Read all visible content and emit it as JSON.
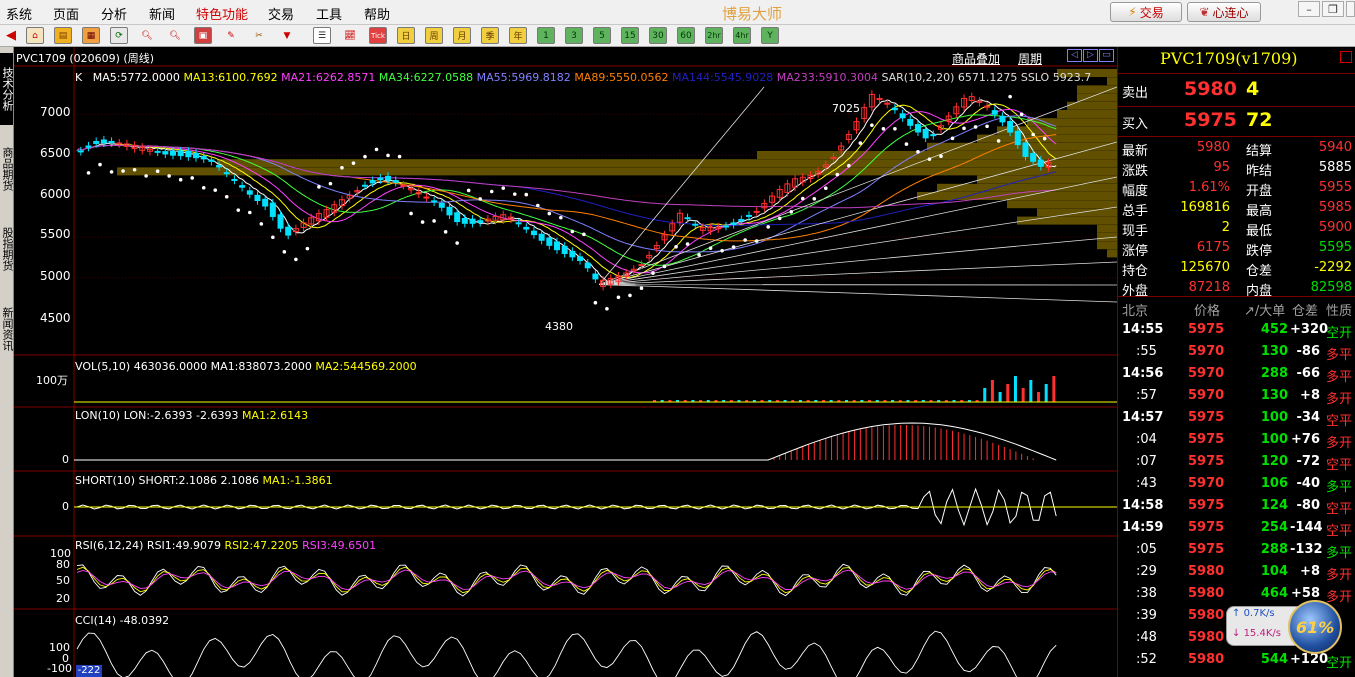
{
  "menubar": {
    "items": [
      "系统",
      "页面",
      "分析",
      "新闻",
      "特色功能",
      "交易",
      "工具",
      "帮助"
    ],
    "app_title": "博易大师",
    "trade_button": "交易",
    "xinlian_button": "心连心"
  },
  "toolbar": {
    "period_buttons": [
      "日",
      "周",
      "月",
      "季",
      "年"
    ],
    "minute_buttons": [
      "1",
      "3",
      "5",
      "15",
      "30",
      "60",
      "2hr",
      "4hr",
      "Y"
    ],
    "tick_label": "Tick"
  },
  "sidetabs": [
    "技术分析",
    "商品期货",
    "股指期货",
    "新闻资讯"
  ],
  "chart": {
    "header": "PVC1709 (020609) (周线)",
    "header_buttons": [
      "商品叠加",
      "周期"
    ],
    "ma_line": {
      "k": "K",
      "ma5": "MA5:5772.0000",
      "ma13": "MA13:6100.7692",
      "ma21": "MA21:6262.8571",
      "ma34": "MA34:6227.0588",
      "ma55": "MA55:5969.8182",
      "ma89": "MA89:5550.0562",
      "ma144": "MA144:5545.9028",
      "ma233": "MA233:5910.3004",
      "sar": "SAR(10,2,20) 6571.1275",
      "sslo": "SSLO 5923.7"
    },
    "price_axis": [
      "7000",
      "6500",
      "6000",
      "5500",
      "5000",
      "4500"
    ],
    "high_label": "7025",
    "low_label": "4380",
    "vol": {
      "title": "VOL(5,10) 463036.0000",
      "ma1": "MA1:838073.2000",
      "ma2": "MA2:544569.2000",
      "axis": "100万"
    },
    "lon": {
      "title": "LON(10) LON:-2.6393 -2.6393",
      "ma1": "MA1:2.6143",
      "axis": "0"
    },
    "short": {
      "title": "SHORT(10) SHORT:2.1086 2.1086",
      "ma1": "MA1:-1.3861",
      "axis": "0"
    },
    "rsi": {
      "title": "RSI(6,12,24) RSI1:49.9079",
      "rsi2": "RSI2:47.2205",
      "rsi3": "RSI3:49.6501",
      "axis": [
        "100",
        "80",
        "50",
        "20"
      ]
    },
    "cci": {
      "title": "CCI(14) -48.0392",
      "axis": [
        "100",
        "0",
        "-100"
      ],
      "current": "-222"
    }
  },
  "quote": {
    "title": "PVC1709(v1709)",
    "sell_label": "卖出",
    "sell_price": "5980",
    "sell_vol": "4",
    "buy_label": "买入",
    "buy_price": "5975",
    "buy_vol": "72",
    "rows": [
      {
        "l1": "最新",
        "v1": "5980",
        "l2": "结算",
        "v2": "5940",
        "c1": "#ff3030",
        "c2": "#ff3030"
      },
      {
        "l1": "涨跌",
        "v1": "95",
        "l2": "昨结",
        "v2": "5885",
        "c1": "#ff3030",
        "c2": "#ffffff"
      },
      {
        "l1": "幅度",
        "v1": "1.61%",
        "l2": "开盘",
        "v2": "5955",
        "c1": "#ff3030",
        "c2": "#ff3030"
      },
      {
        "l1": "总手",
        "v1": "169816",
        "l2": "最高",
        "v2": "5985",
        "c1": "#ffff00",
        "c2": "#ff3030"
      },
      {
        "l1": "现手",
        "v1": "2",
        "l2": "最低",
        "v2": "5900",
        "c1": "#ffff00",
        "c2": "#ff3030"
      },
      {
        "l1": "涨停",
        "v1": "6175",
        "l2": "跌停",
        "v2": "5595",
        "c1": "#ff3030",
        "c2": "#00e000"
      },
      {
        "l1": "持仓",
        "v1": "125670",
        "l2": "仓差",
        "v2": "-2292",
        "c1": "#ffff00",
        "c2": "#ffff00"
      },
      {
        "l1": "外盘",
        "v1": "87218",
        "l2": "内盘",
        "v2": "82598",
        "c1": "#ff3030",
        "c2": "#00e000"
      }
    ],
    "ticks_header": [
      "北京",
      "价格",
      "↗/大单",
      "仓差",
      "性质"
    ],
    "ticks": [
      {
        "time": "14:55",
        "price": "5975",
        "vol": "452",
        "diff": "+320",
        "type": "空开",
        "major": true,
        "tc": "#00e000"
      },
      {
        "time": ":55",
        "price": "5970",
        "vol": "130",
        "diff": "-86",
        "type": "多平",
        "major": false,
        "tc": "#ff3030"
      },
      {
        "time": "14:56",
        "price": "5970",
        "vol": "288",
        "diff": "-66",
        "type": "多平",
        "major": true,
        "tc": "#ff3030"
      },
      {
        "time": ":57",
        "price": "5970",
        "vol": "130",
        "diff": "+8",
        "type": "多开",
        "major": false,
        "tc": "#ff3030"
      },
      {
        "time": "14:57",
        "price": "5975",
        "vol": "100",
        "diff": "-34",
        "type": "空平",
        "major": true,
        "tc": "#ff3030"
      },
      {
        "time": ":04",
        "price": "5975",
        "vol": "100",
        "diff": "+76",
        "type": "多开",
        "major": false,
        "tc": "#ff3030"
      },
      {
        "time": ":07",
        "price": "5975",
        "vol": "120",
        "diff": "-72",
        "type": "空平",
        "major": false,
        "tc": "#ff3030"
      },
      {
        "time": ":43",
        "price": "5970",
        "vol": "106",
        "diff": "-40",
        "type": "多平",
        "major": false,
        "tc": "#00e000"
      },
      {
        "time": "14:58",
        "price": "5975",
        "vol": "124",
        "diff": "-80",
        "type": "空平",
        "major": true,
        "tc": "#ff3030"
      },
      {
        "time": "14:59",
        "price": "5975",
        "vol": "254",
        "diff": "-144",
        "type": "空平",
        "major": true,
        "tc": "#ff3030"
      },
      {
        "time": ":05",
        "price": "5975",
        "vol": "288",
        "diff": "-132",
        "type": "多平",
        "major": false,
        "tc": "#00e000"
      },
      {
        "time": ":29",
        "price": "5980",
        "vol": "104",
        "diff": "+8",
        "type": "多开",
        "major": false,
        "tc": "#ff3030"
      },
      {
        "time": ":38",
        "price": "5980",
        "vol": "464",
        "diff": "+58",
        "type": "多开",
        "major": false,
        "tc": "#ff3030"
      },
      {
        "time": ":39",
        "price": "5980",
        "vol": "",
        "diff": "",
        "type": "",
        "major": false,
        "tc": "#ff3030"
      },
      {
        "time": ":48",
        "price": "5980",
        "vol": "",
        "diff": "",
        "type": "",
        "major": false,
        "tc": "#ff3030"
      },
      {
        "time": ":52",
        "price": "5980",
        "vol": "544",
        "diff": "+120",
        "type": "空开",
        "major": false,
        "tc": "#00e000"
      }
    ]
  },
  "speed": {
    "up": "0.7K/s",
    "down": "15.4K/s",
    "percent": "61%"
  }
}
